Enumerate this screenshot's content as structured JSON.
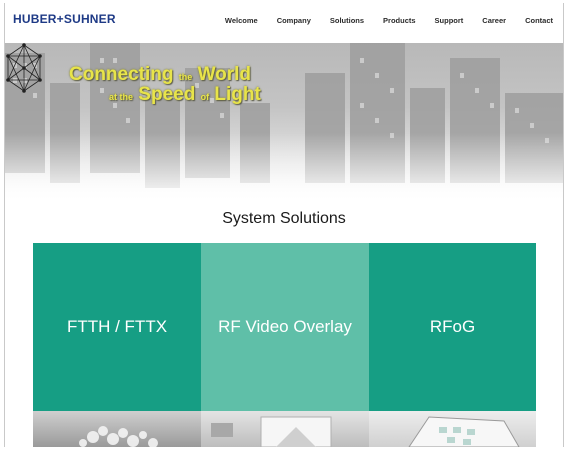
{
  "header": {
    "logo": "HUBER+SUHNER",
    "nav": [
      "Welcome",
      "Company",
      "Solutions",
      "Products",
      "Support",
      "Career",
      "Contact"
    ]
  },
  "hero": {
    "tagline_line1_a": "Connecting",
    "tagline_line1_b": "the",
    "tagline_line1_c": "World",
    "tagline_line2_a": "at the",
    "tagline_line2_b": "Speed",
    "tagline_line2_c": "of",
    "tagline_line2_d": "Light",
    "icon": "network-polyhedron-icon"
  },
  "section": {
    "title": "System Solutions"
  },
  "tiles": [
    {
      "label": "FTTH / FTTX"
    },
    {
      "label": "RF Video Overlay"
    },
    {
      "label": "RFoG"
    }
  ],
  "colors": {
    "brand_blue": "#1e3a86",
    "tile_dark": "#169e84",
    "tile_light": "#5fbfa8",
    "tagline": "#e8e44a"
  }
}
